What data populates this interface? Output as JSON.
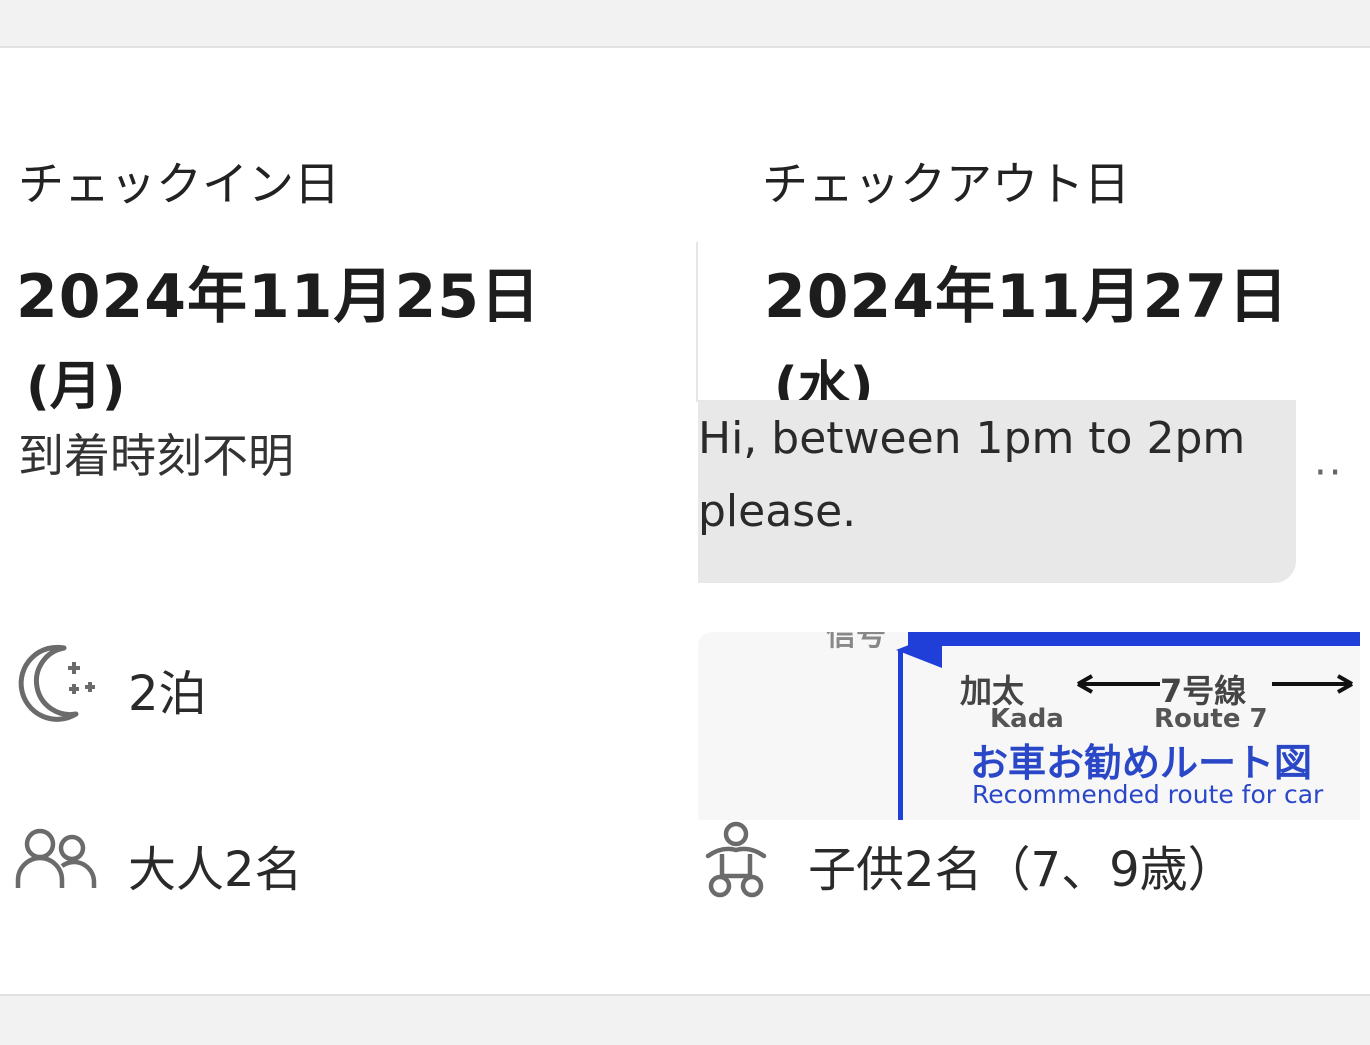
{
  "checkin": {
    "label": "チェックイン日",
    "date": "2024年11月25日",
    "weekday": "(月)",
    "arrival": "到着時刻不明"
  },
  "checkout": {
    "label": "チェックアウト日",
    "date": "2024年11月27日",
    "weekday": "(水)"
  },
  "message": {
    "text": "Hi, between 1pm to 2pm please.",
    "more": "··"
  },
  "stay": {
    "nights": "2泊",
    "adults": "大人2名",
    "children": "子供2名（7、9歳）"
  },
  "map_image": {
    "top_text": "信号",
    "place_jp": "加太",
    "place_en": "Kada",
    "route_jp": "7号線",
    "route_en": "Route 7",
    "title_jp": "お車お勧めルート図",
    "title_en": "Recommended route for car",
    "line_color": "#1f3fd8"
  },
  "icons": {
    "nights": "moon-stars-icon",
    "adults": "people-icon",
    "children": "baby-icon"
  }
}
